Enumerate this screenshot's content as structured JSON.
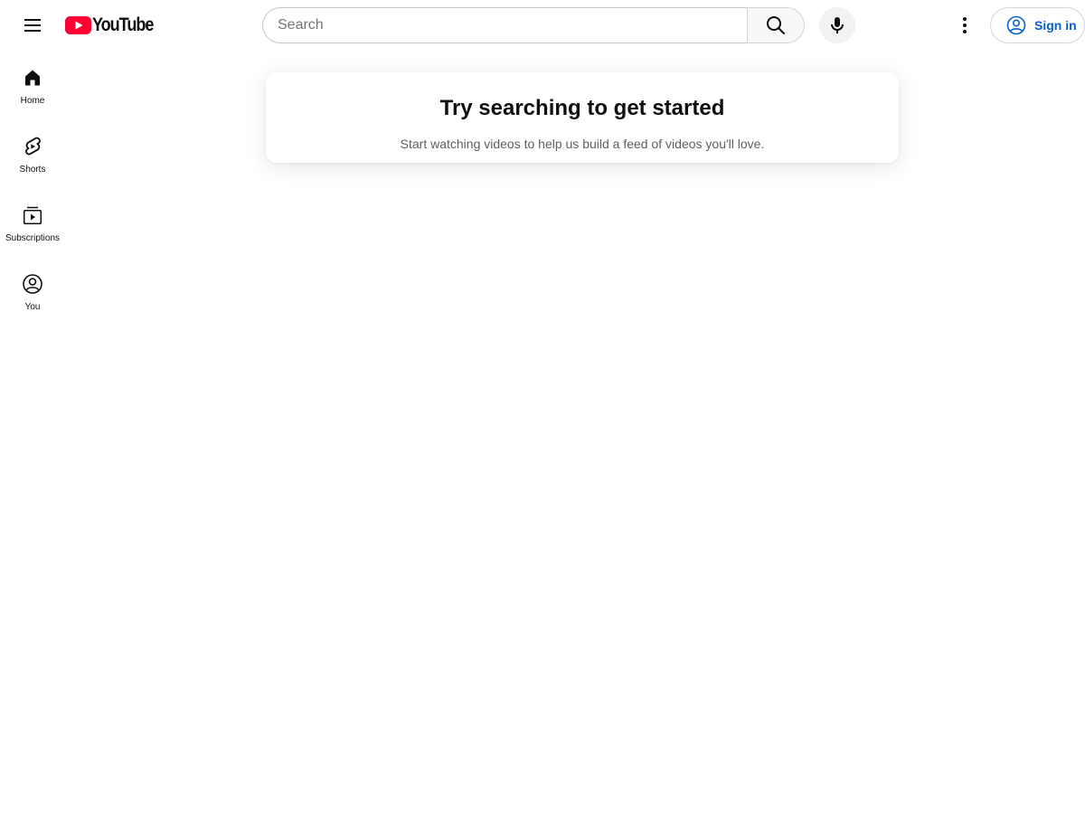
{
  "header": {
    "menu_icon": "hamburger-menu-icon",
    "logo_text": "YouTube",
    "logo_color": "#ff0033",
    "search": {
      "placeholder": "Search",
      "value": ""
    },
    "search_icon": "search-icon",
    "mic_icon": "microphone-icon",
    "more_icon": "vertical-dots-icon",
    "sign_in": {
      "label": "Sign in",
      "icon": "account-circle-icon",
      "color": "#065fd4"
    }
  },
  "sidebar": {
    "items": [
      {
        "label": "Home",
        "icon": "home-icon"
      },
      {
        "label": "Shorts",
        "icon": "shorts-icon"
      },
      {
        "label": "Subscriptions",
        "icon": "subscriptions-icon"
      },
      {
        "label": "You",
        "icon": "account-icon"
      }
    ]
  },
  "main": {
    "title": "Try searching to get started",
    "subtitle": "Start watching videos to help us build a feed of videos you'll love."
  }
}
